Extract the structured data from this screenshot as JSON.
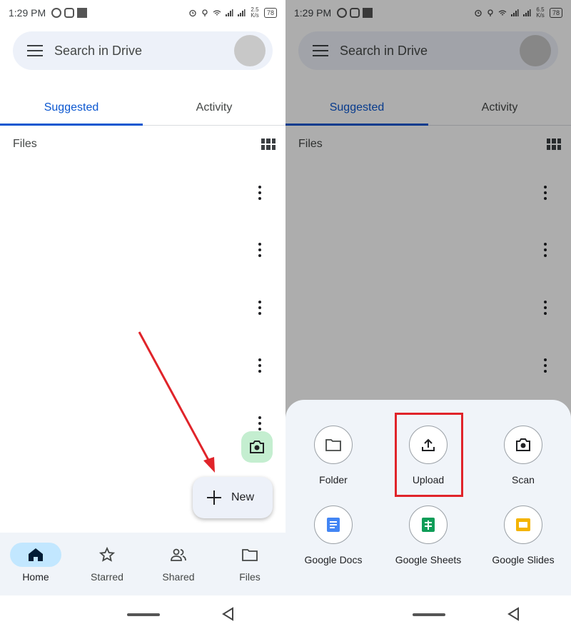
{
  "status_bar": {
    "time": "1:29 PM",
    "battery": "78",
    "speed_left": [
      "2.5",
      "K/s"
    ],
    "speed_right": [
      "6.5",
      "K/s"
    ]
  },
  "search": {
    "placeholder": "Search in Drive"
  },
  "tabs": [
    {
      "label": "Suggested",
      "active": true
    },
    {
      "label": "Activity",
      "active": false
    }
  ],
  "files": {
    "header": "Files",
    "row_count": 5
  },
  "fab": {
    "new_label": "New",
    "camera_icon": "camera-icon",
    "fab_color": "#c4eed0"
  },
  "bottom_nav": [
    {
      "label": "Home",
      "icon": "home-icon",
      "active": true
    },
    {
      "label": "Starred",
      "icon": "star-icon",
      "active": false
    },
    {
      "label": "Shared",
      "icon": "people-icon",
      "active": false
    },
    {
      "label": "Files",
      "icon": "folder-icon",
      "active": false
    }
  ],
  "create_sheet": {
    "items": [
      {
        "label": "Folder",
        "icon": "folder-icon"
      },
      {
        "label": "Upload",
        "icon": "upload-icon"
      },
      {
        "label": "Scan",
        "icon": "camera-icon"
      },
      {
        "label": "Google Docs",
        "icon": "docs-icon"
      },
      {
        "label": "Google Sheets",
        "icon": "sheets-icon"
      },
      {
        "label": "Google Slides",
        "icon": "slides-icon"
      }
    ]
  },
  "colors": {
    "accent": "#0b57d0",
    "highlight": "#e0242a",
    "docs": "#4285f4",
    "sheets": "#0f9d58",
    "slides": "#f4b400"
  }
}
